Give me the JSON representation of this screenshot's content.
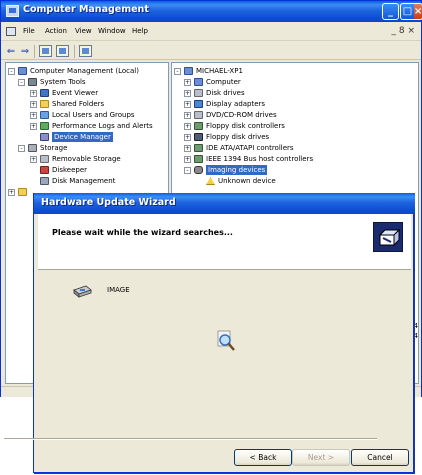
{
  "main_window": {
    "title": "Computer Management",
    "menu": [
      "File",
      "Action",
      "View",
      "Window",
      "Help"
    ],
    "mdi_controls": "_ 8 ×"
  },
  "left_tree": [
    {
      "label": "Computer Management (Local)",
      "expander": "-",
      "icon": "computer-management-icon"
    },
    {
      "label": "System Tools",
      "expander": "-",
      "icon": "system-tools-icon"
    },
    {
      "label": "Event Viewer",
      "expander": "+",
      "icon": "event-viewer-icon"
    },
    {
      "label": "Shared Folders",
      "expander": "+",
      "icon": "shared-folders-icon"
    },
    {
      "label": "Local Users and Groups",
      "expander": "+",
      "icon": "users-icon"
    },
    {
      "label": "Performance Logs and Alerts",
      "expander": "+",
      "icon": "performance-icon"
    },
    {
      "label": "Device Manager",
      "expander": "",
      "icon": "device-manager-icon",
      "selected": true
    },
    {
      "label": "Storage",
      "expander": "-",
      "icon": "storage-icon"
    },
    {
      "label": "Removable Storage",
      "expander": "+",
      "icon": "removable-storage-icon"
    },
    {
      "label": "Diskeeper",
      "expander": "",
      "icon": "diskeeper-icon"
    },
    {
      "label": "Disk Management",
      "expander": "",
      "icon": "disk-management-icon"
    },
    {
      "label": "",
      "expander": "+",
      "icon": "services-icon"
    }
  ],
  "right_tree": [
    {
      "label": "MICHAEL-XP1",
      "expander": "-",
      "icon": "computer-icon"
    },
    {
      "label": "Computer",
      "expander": "+",
      "icon": "computer-icon"
    },
    {
      "label": "Disk drives",
      "expander": "+",
      "icon": "disk-drive-icon"
    },
    {
      "label": "Display adapters",
      "expander": "+",
      "icon": "display-adapter-icon"
    },
    {
      "label": "DVD/CD-ROM drives",
      "expander": "+",
      "icon": "dvd-icon"
    },
    {
      "label": "Floppy disk controllers",
      "expander": "+",
      "icon": "controller-icon"
    },
    {
      "label": "Floppy disk drives",
      "expander": "+",
      "icon": "floppy-icon"
    },
    {
      "label": "IDE ATA/ATAPI controllers",
      "expander": "+",
      "icon": "controller-icon"
    },
    {
      "label": "IEEE 1394 Bus host controllers",
      "expander": "+",
      "icon": "controller-icon"
    },
    {
      "label": "Imaging devices",
      "expander": "-",
      "icon": "camera-icon",
      "selected": true
    },
    {
      "label": "Unknown device",
      "expander": "",
      "icon": "warning-icon"
    }
  ],
  "right_overflow": [
    "- 244",
    "- 244"
  ],
  "wizard": {
    "title": "Hardware Update Wizard",
    "heading": "Please wait while the wizard searches...",
    "device_label": "IMAGE",
    "back_label": "< Back",
    "next_label": "Next >",
    "cancel_label": "Cancel"
  },
  "colors": {
    "titlebar": "#0a5fe0",
    "selection": "#316ac5",
    "window_face": "#ece9d8"
  }
}
